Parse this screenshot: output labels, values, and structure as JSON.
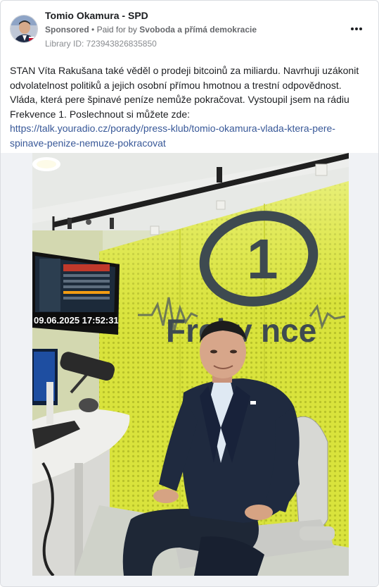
{
  "post": {
    "page_name": "Tomio Okamura - SPD",
    "sponsored_label": "Sponsored",
    "separator": "•",
    "paid_for_prefix": "Paid for by",
    "paid_for_by": "Svoboda a přímá demokracie",
    "library_id": "Library ID: 723943826835850",
    "text_line_1": "STAN Víta Rakušana také věděl o prodeji bitcoinů za miliardu. Navrhuji uzákonit",
    "text_line_2": "odvolatelnost politiků a jejich osobní přímou hmotnou a trestní odpovědnost.",
    "text_line_3": "Vláda, která pere špinavé peníze nemůže pokračovat. Vystoupil jsem na rádiu",
    "text_line_4": "Frekvence 1. Poslechnout si můžete zde:",
    "link_line_1": "https://talk.youradio.cz/porady/press-klub/tomio-okamura-vlada-ktera-pere-",
    "link_line_2": "spinave-penize-nemuze-pokracovat"
  },
  "photo": {
    "monitor_timestamp": "09.06.2025 17:52:31",
    "logo_number": "1",
    "logo_word_part1": "Frekv",
    "logo_word_part2": "nce",
    "logo_e": "e"
  },
  "colors": {
    "link": "#385898",
    "wall_yellow": "#d8e23a",
    "studio_gray": "#e6e8e4"
  },
  "icons": {
    "more": "more-horizontal-icon"
  }
}
